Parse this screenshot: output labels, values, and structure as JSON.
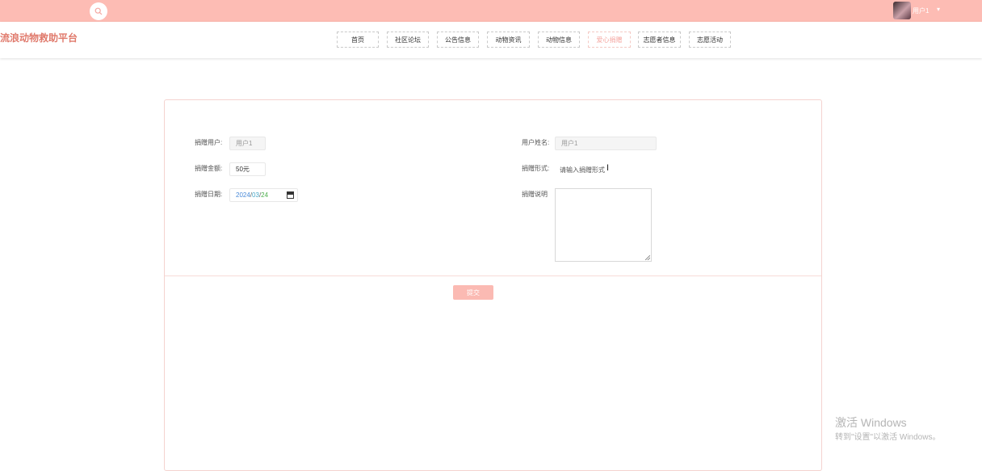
{
  "top_bar": {
    "search_icon": "search-icon",
    "user_name": "用户1",
    "caret": "▾"
  },
  "header": {
    "site_title": "流浪动物救助平台",
    "nav": [
      {
        "label": "首页"
      },
      {
        "label": "社区论坛"
      },
      {
        "label": "公告信息"
      },
      {
        "label": "动物资讯"
      },
      {
        "label": "动物信息"
      },
      {
        "label": "爱心捐赠"
      },
      {
        "label": "志愿者信息"
      },
      {
        "label": "志愿活动"
      }
    ]
  },
  "form": {
    "donor_user": {
      "label": "捐赠用户:",
      "value": "用户1"
    },
    "user_name": {
      "label": "用户姓名:",
      "value": "用户1"
    },
    "amount": {
      "label": "捐赠金额:",
      "value": "50元"
    },
    "form_type": {
      "label": "捐赠形式:",
      "placeholder": "请输入捐赠形式"
    },
    "date": {
      "label": "捐赠日期:",
      "year": "2024",
      "month": "03",
      "day": "24",
      "separator": "/"
    },
    "description": {
      "label": "捐赠说明"
    },
    "submit_label": "提交"
  },
  "watermark": {
    "title": "激活 Windows",
    "subtitle": "转到\"设置\"以激活 Windows。"
  },
  "colors": {
    "top_bar": "#fdbcb4",
    "accent": "#e07a6c",
    "button": "#fbbab3"
  }
}
